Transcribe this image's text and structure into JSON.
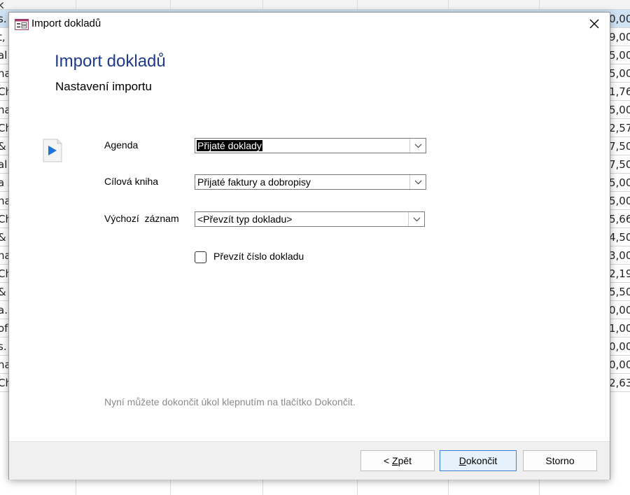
{
  "background": {
    "left_fragments": [
      "k",
      "s.",
      "t,",
      "al",
      "na",
      "Ch",
      "na",
      "Ch",
      "&",
      "al",
      "a s",
      "na",
      "Ch",
      "&",
      "na",
      "Ch",
      "&",
      "a.",
      "of",
      "s.",
      "na",
      "Ch"
    ],
    "right_fragments": [
      "",
      "0,00",
      "9,00",
      "5,00",
      "5,00",
      "1,76",
      "5,00",
      "2,57",
      "7,50",
      "7,50",
      "5,00",
      "5,00",
      "5,66",
      "4,50",
      "3,00",
      "2,19",
      "5,50",
      "0,00",
      "1,00",
      "0,00",
      "0,00",
      "2,63"
    ]
  },
  "window": {
    "title": "Import dokladů",
    "app_icon": "form-icon",
    "close_icon": "close-icon"
  },
  "header": {
    "title": "Import dokladů",
    "subtitle": "Nastavení importu",
    "side_icon": "play-arrow-icon",
    "accent_color": "#1f3b8f"
  },
  "form": {
    "agenda": {
      "label": "Agenda",
      "value": "Přijaté doklady"
    },
    "target_book": {
      "label": "Cílová kniha",
      "value": "Přijaté faktury a dobropisy"
    },
    "default_record": {
      "label": "Výchozí  záznam",
      "value": "<Převzít typ dokladu>"
    },
    "take_number": {
      "label": "Převzít číslo dokladu",
      "checked": false
    }
  },
  "hint": "Nyní můžete dokončit úkol klepnutím na tlačítko Dokončit.",
  "buttons": {
    "back_prefix": "< ",
    "back_hotkey": "Z",
    "back_rest": "pět",
    "finish_hotkey": "D",
    "finish_rest": "okončit",
    "cancel": "Storno"
  }
}
